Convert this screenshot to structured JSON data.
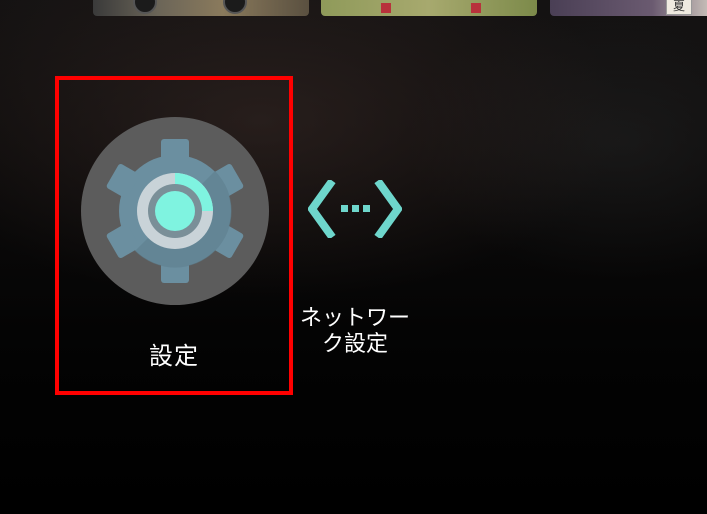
{
  "thumbnails": [
    {
      "name": "game-thumbnail-1"
    },
    {
      "name": "game-thumbnail-2"
    },
    {
      "name": "game-thumbnail-3",
      "tile_text": "夏"
    }
  ],
  "apps": [
    {
      "id": "settings",
      "label": "設定",
      "icon": "gear-icon",
      "selected": true
    },
    {
      "id": "network",
      "label_line1": "ネットワー",
      "label_line2": "ク設定",
      "icon": "network-icon",
      "selected": false
    }
  ],
  "colors": {
    "selection_border": "#ff0000",
    "gear_body": "#6b8fa0",
    "gear_accent": "#7ff3e0",
    "network_accent": "#6ed6cc",
    "circle_bg": "#5c5c5c"
  }
}
